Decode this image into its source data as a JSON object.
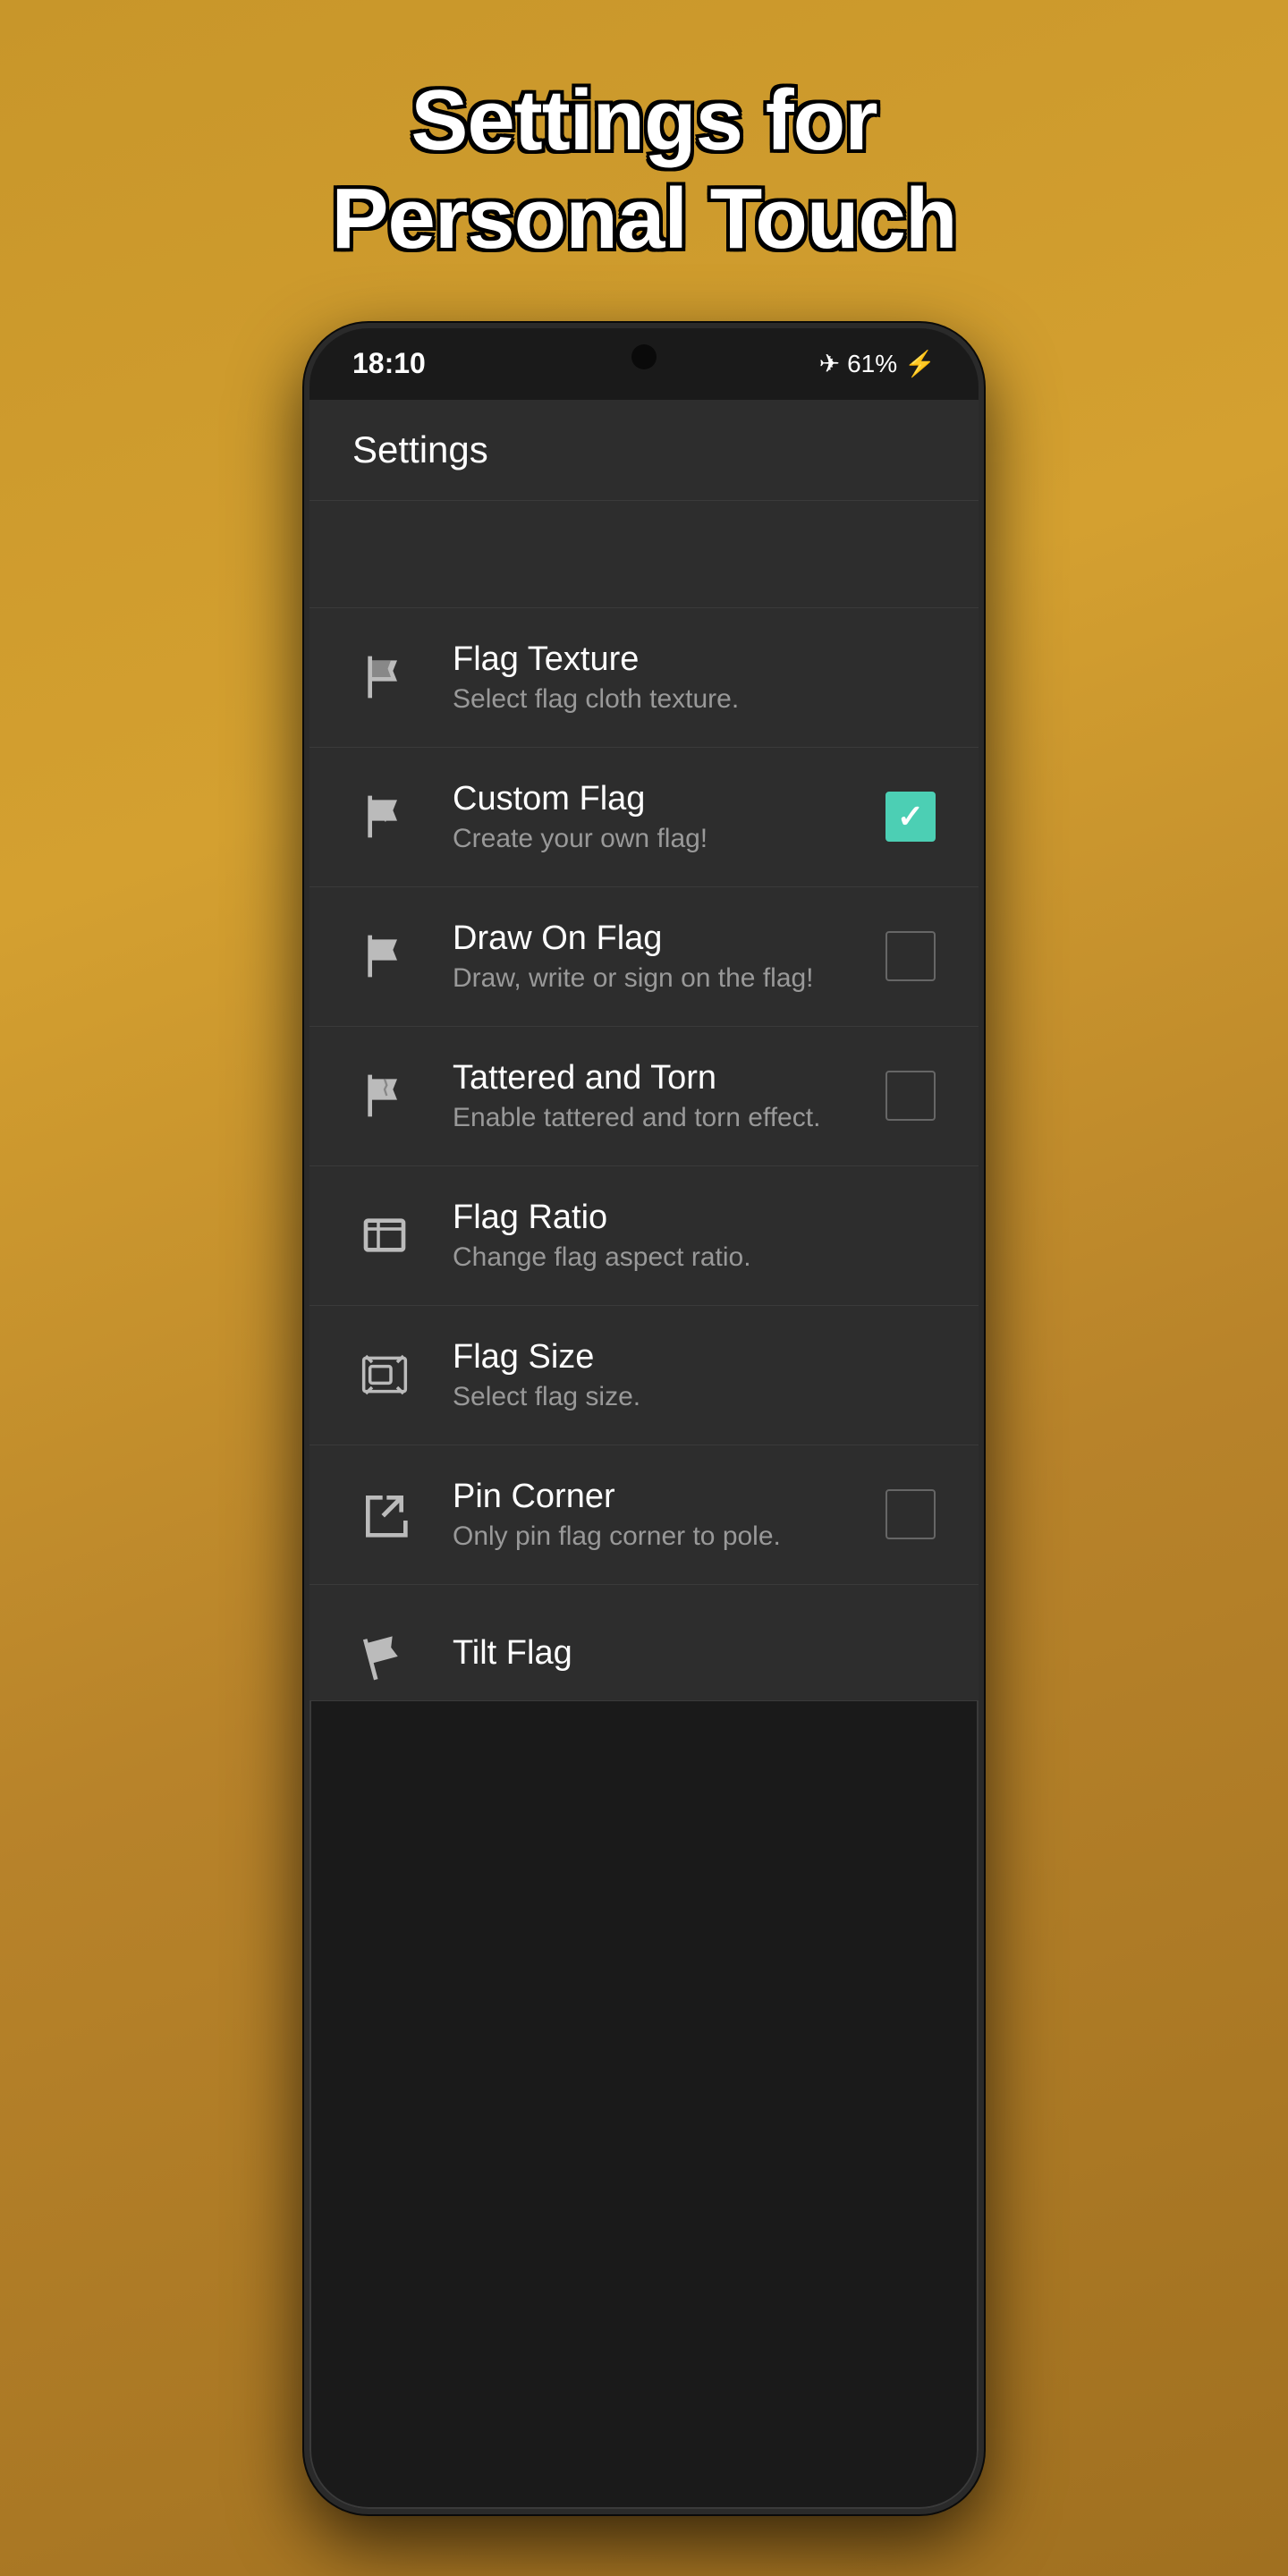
{
  "page": {
    "title_line1": "Settings for",
    "title_line2": "Personal Touch"
  },
  "status_bar": {
    "time": "18:10",
    "battery": "61%",
    "signal": "✈"
  },
  "header": {
    "title": "Settings"
  },
  "settings": {
    "items": [
      {
        "id": "flag-texture",
        "title": "Flag Texture",
        "subtitle": "Select flag cloth texture.",
        "has_checkbox": false,
        "checked": false
      },
      {
        "id": "custom-flag",
        "title": "Custom Flag",
        "subtitle": "Create your own flag!",
        "has_checkbox": true,
        "checked": true
      },
      {
        "id": "draw-on-flag",
        "title": "Draw On Flag",
        "subtitle": "Draw, write or sign on the flag!",
        "has_checkbox": true,
        "checked": false
      },
      {
        "id": "tattered-and-torn",
        "title": "Tattered and Torn",
        "subtitle": "Enable tattered and torn effect.",
        "has_checkbox": true,
        "checked": false
      },
      {
        "id": "flag-ratio",
        "title": "Flag Ratio",
        "subtitle": "Change flag aspect ratio.",
        "has_checkbox": false,
        "checked": false
      },
      {
        "id": "flag-size",
        "title": "Flag Size",
        "subtitle": "Select flag size.",
        "has_checkbox": false,
        "checked": false
      },
      {
        "id": "pin-corner",
        "title": "Pin Corner",
        "subtitle": "Only pin flag corner to pole.",
        "has_checkbox": true,
        "checked": false
      },
      {
        "id": "tilt-flag",
        "title": "Tilt Flag",
        "subtitle": "",
        "has_checkbox": false,
        "checked": false,
        "partial": true
      }
    ]
  }
}
